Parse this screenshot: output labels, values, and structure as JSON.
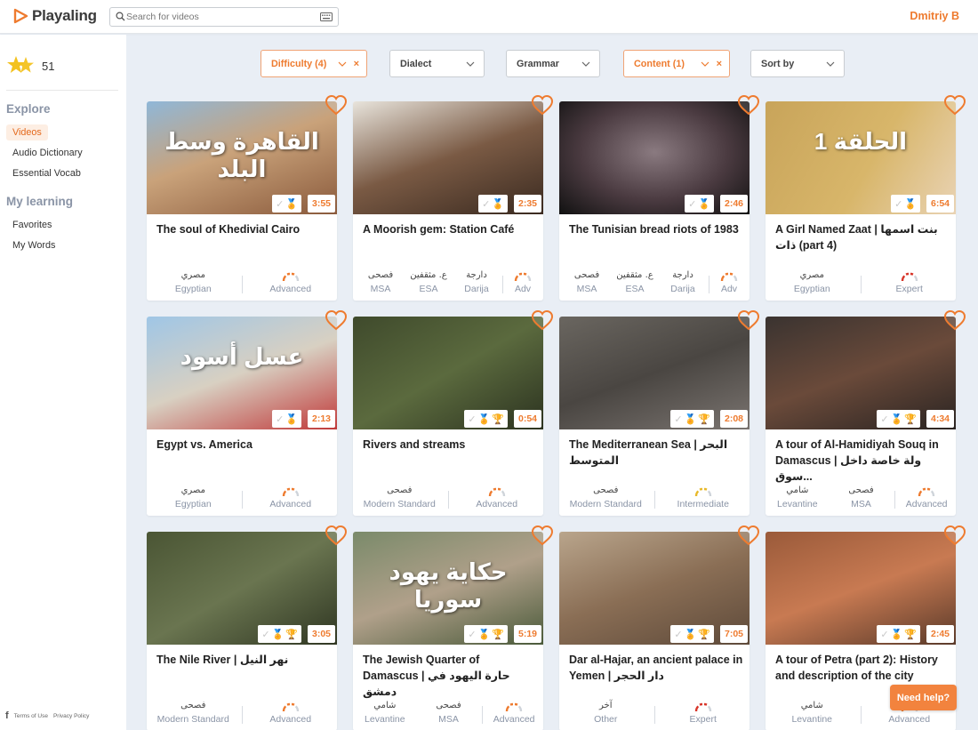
{
  "app": {
    "name": "Playaling",
    "user": "Dmitriy B"
  },
  "search": {
    "placeholder": "Search for videos"
  },
  "sidebar": {
    "stars": "51",
    "explore_heading": "Explore",
    "explore_items": [
      "Videos",
      "Audio Dictionary",
      "Essential Vocab"
    ],
    "learning_heading": "My learning",
    "learning_items": [
      "Favorites",
      "My Words"
    ],
    "footer": {
      "terms": "Terms of Use",
      "privacy": "Privacy Policy"
    }
  },
  "filters": [
    {
      "label": "Difficulty (4)",
      "active": true
    },
    {
      "label": "Dialect",
      "active": false
    },
    {
      "label": "Grammar",
      "active": false
    },
    {
      "label": "Content (1)",
      "active": true
    },
    {
      "label": "Sort by",
      "active": false
    }
  ],
  "videos": [
    {
      "title": "The soul of Khedivial Cairo",
      "duration": "3:55",
      "thumb_text": "القاهرة وسط البلد",
      "dialects": [
        {
          "ar": "مصري",
          "en": "Egyptian"
        }
      ],
      "level": "Advanced"
    },
    {
      "title": "A Moorish gem: Station Café",
      "duration": "2:35",
      "thumb_text": "",
      "dialects": [
        {
          "ar": "فصحى",
          "en": "MSA"
        },
        {
          "ar": "ع. مثقفين",
          "en": "ESA"
        },
        {
          "ar": "دارجة",
          "en": "Darija"
        }
      ],
      "level": "Adv"
    },
    {
      "title": "The Tunisian bread riots of 1983",
      "duration": "2:46",
      "thumb_text": "",
      "dialects": [
        {
          "ar": "فصحى",
          "en": "MSA"
        },
        {
          "ar": "ع. مثقفين",
          "en": "ESA"
        },
        {
          "ar": "دارجة",
          "en": "Darija"
        }
      ],
      "level": "Adv"
    },
    {
      "title": "A Girl Named Zaat | بنت اسمها ذات (part 4)",
      "duration": "6:54",
      "thumb_text": "الحلقة 1",
      "dialects": [
        {
          "ar": "مصري",
          "en": "Egyptian"
        }
      ],
      "level": "Expert"
    },
    {
      "title": "Egypt vs. America",
      "duration": "2:13",
      "thumb_text": "عسل أسود",
      "dialects": [
        {
          "ar": "مصري",
          "en": "Egyptian"
        }
      ],
      "level": "Advanced"
    },
    {
      "title": "Rivers and streams",
      "duration": "0:54",
      "thumb_text": "",
      "dialects": [
        {
          "ar": "فصحى",
          "en": "Modern Standard"
        }
      ],
      "level": "Advanced"
    },
    {
      "title": "The Mediterranean Sea | البحر المتوسط",
      "duration": "2:08",
      "thumb_text": "",
      "dialects": [
        {
          "ar": "فصحى",
          "en": "Modern Standard"
        }
      ],
      "level": "Intermediate"
    },
    {
      "title": "A tour of Al-Hamidiyah Souq in Damascus | ولة خاصة داخل سوق...",
      "duration": "4:34",
      "thumb_text": "",
      "dialects": [
        {
          "ar": "شامي",
          "en": "Levantine"
        },
        {
          "ar": "فصحى",
          "en": "MSA"
        }
      ],
      "level": "Advanced"
    },
    {
      "title": "The Nile River | نهر النيل",
      "duration": "3:05",
      "thumb_text": "",
      "dialects": [
        {
          "ar": "فصحى",
          "en": "Modern Standard"
        }
      ],
      "level": "Advanced"
    },
    {
      "title": "The Jewish Quarter of Damascus | حارة اليهود في دمشق",
      "duration": "5:19",
      "thumb_text": "حكاية يهود سوريا",
      "dialects": [
        {
          "ar": "شامي",
          "en": "Levantine"
        },
        {
          "ar": "فصحى",
          "en": "MSA"
        }
      ],
      "level": "Advanced"
    },
    {
      "title": "Dar al-Hajar, an ancient palace in Yemen | دار الحجر",
      "duration": "7:05",
      "thumb_text": "",
      "dialects": [
        {
          "ar": "آخر",
          "en": "Other"
        }
      ],
      "level": "Expert"
    },
    {
      "title": "A tour of Petra (part 2): History and description of the city",
      "duration": "2:45",
      "thumb_text": "",
      "dialects": [
        {
          "ar": "شامي",
          "en": "Levantine"
        }
      ],
      "level": "Advanced"
    }
  ],
  "help_button": "Need help?",
  "colors": {
    "accent": "#ee7b2f",
    "muted": "#8a94a6",
    "background": "#e9eef5",
    "gold": "#e8b92a"
  }
}
